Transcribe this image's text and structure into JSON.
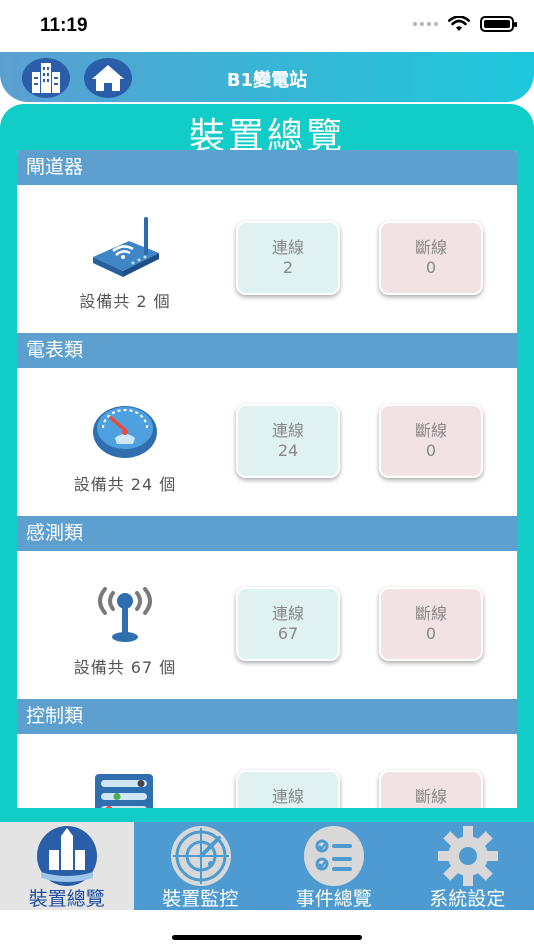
{
  "status_bar": {
    "time": "11:19"
  },
  "header": {
    "title": "B1變電站"
  },
  "page": {
    "title": "裝置總覽"
  },
  "sections": [
    {
      "title": "閘道器",
      "count_label": "設備共 2 個",
      "online_label": "連線",
      "online_value": "2",
      "offline_label": "斷線",
      "offline_value": "0",
      "icon": "router-icon"
    },
    {
      "title": "電表類",
      "count_label": "設備共 24 個",
      "online_label": "連線",
      "online_value": "24",
      "offline_label": "斷線",
      "offline_value": "0",
      "icon": "meter-gauge-icon"
    },
    {
      "title": "感測類",
      "count_label": "設備共 67 個",
      "online_label": "連線",
      "online_value": "67",
      "offline_label": "斷線",
      "offline_value": "0",
      "icon": "sensor-antenna-icon"
    },
    {
      "title": "控制類",
      "count_label": "",
      "online_label": "連線",
      "online_value": "",
      "offline_label": "斷線",
      "offline_value": "",
      "icon": "control-panel-icon"
    }
  ],
  "tabs": [
    {
      "label": "裝置總覽",
      "icon": "device-overview-icon",
      "active": true
    },
    {
      "label": "裝置監控",
      "icon": "radar-icon",
      "active": false
    },
    {
      "label": "事件總覽",
      "icon": "checklist-icon",
      "active": false
    },
    {
      "label": "系統設定",
      "icon": "gear-icon",
      "active": false
    }
  ],
  "colors": {
    "header_gradient": [
      "#5b9fd1",
      "#1ec8dc"
    ],
    "frame": "#12cdc7",
    "section_header": "#5d9fcf",
    "online_box": "#e0f1f1",
    "offline_box": "#f3e2e3",
    "tabbar": "#4d9bd0",
    "active_tab": "#e4e4e4"
  }
}
